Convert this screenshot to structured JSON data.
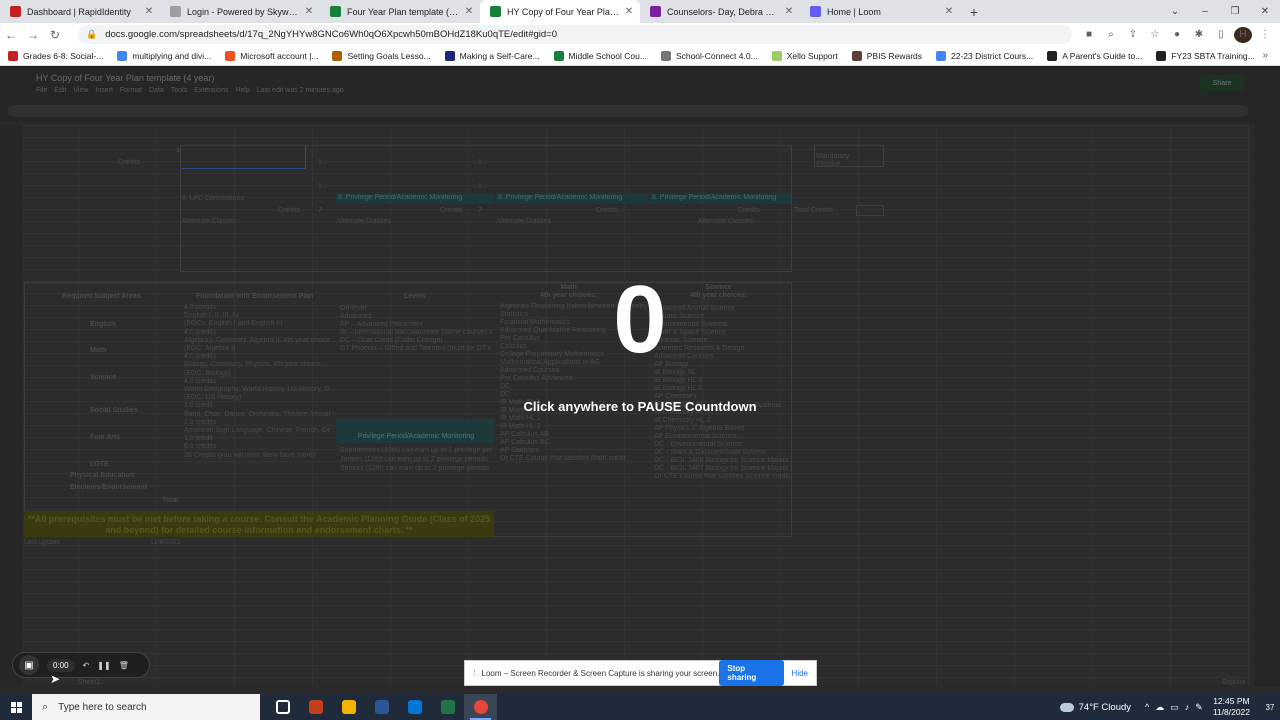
{
  "tabs": [
    {
      "title": "Dashboard | RapidIdentity",
      "color": "#c5221f"
    },
    {
      "title": "Login - Powered by Skyward",
      "color": "#9e9e9e"
    },
    {
      "title": "Four Year Plan template (4 year)",
      "color": "#188038"
    },
    {
      "title": "HY Copy of Four Year Plan template (4 year)",
      "color": "#188038",
      "active": true
    },
    {
      "title": "Counselors- Day, Debra & Young",
      "color": "#7b1fa2"
    },
    {
      "title": "Home | Loom",
      "color": "#625df5"
    }
  ],
  "new_tab_label": "+",
  "address_bar": {
    "url": "docs.google.com/spreadsheets/d/17q_2NgYHYw8GNCo6Wh0qO6Xpcwh50mBOHdZ18Ku0qTE/edit#gid=0"
  },
  "profile_initial": "H",
  "bookmarks": [
    {
      "label": "Grades 6-8: Social-...",
      "color": "#c5221f"
    },
    {
      "label": "multiplying and divi...",
      "color": "#4285f4"
    },
    {
      "label": "Microsoft account |...",
      "color": "#f25022"
    },
    {
      "label": "Setting Goals Lesso...",
      "color": "#b06000"
    },
    {
      "label": "Making a Self-Care...",
      "color": "#1a237e"
    },
    {
      "label": "Middle School Cou...",
      "color": "#188038"
    },
    {
      "label": "School-Connect 4.0...",
      "color": "#757575"
    },
    {
      "label": "Xello Support",
      "color": "#9ccc65"
    },
    {
      "label": "PBIS Rewards",
      "color": "#5d4037"
    },
    {
      "label": "22-23 District Cours...",
      "color": "#4285f4"
    },
    {
      "label": "A Parent's Guide to...",
      "color": "#202124"
    },
    {
      "label": "FY23 SBTA Training...",
      "color": "#212121"
    }
  ],
  "bookmarks_more": "»",
  "sheet": {
    "doc_title": "HY Copy of Four Year Plan template (4 year)",
    "menu": [
      "File",
      "Edit",
      "View",
      "Insert",
      "Format",
      "Data",
      "Tools",
      "Extensions",
      "Help",
      "Last edit was 2 minutes ago"
    ],
    "share_label": "Share",
    "credits_label": "Credits",
    "credits_value": "1",
    "mandatory_elective": "Mandatory Elective",
    "lfc_connections": "8. LFC Connections",
    "privilege_period": "8. Privilege Period/Academic Monitoring",
    "credits_7": "7",
    "total_credits": "Total Credits",
    "alternate_classes": "Alternate Classes",
    "headers": {
      "required": "Required Subject Areas",
      "foundation": "Foundation with Endorsement Plan",
      "levels": "Levels",
      "math": "Math\n4th year choices:",
      "science": "Science\n4th year choices:"
    },
    "subjects": [
      "English",
      "Math",
      "Science",
      "Social Studies",
      "Fine Arts",
      "LOTE",
      "Physical Education",
      "Electives/Endorsement",
      "Total"
    ],
    "foundation_lines": [
      "4.0 credits",
      "English I, II, III, IV",
      "(EOCs: English I and English II)",
      "4.0 credits",
      "Algebra I, Geometry, Algebra II, 4th year choice",
      "(EOC: Algebra I)",
      "4.0 credits",
      "Biology, Chemistry, Physics, 4th year choice",
      "(EOC: Biology)",
      "4.0 credits",
      "World Geography, World History, US History, Government/Economics",
      "(EOC: US History)",
      "1.0 credit",
      "Band, Choir, Dance, Orchestra, Theatre, Visual Arts",
      "2.0 credits",
      "American Sign Language, Chinese, French, German, Spanish",
      "1.0 credit",
      "6.0 credits",
      "26 Credits (you will most likely have more)"
    ],
    "levels_lines": [
      "On-level",
      "Advanced",
      "AP – Advanced Placement",
      "IB – International Baccalaureate (some courses are reserved for full diploma candidates)",
      "DC – Dual Credit (Collin College)",
      "GT Phoenix – Gifted and Talented (must be GT identified)"
    ],
    "privilege_header": "Privilege Period/Academic Monitoring",
    "privilege_lines": [
      "Sophomores (10th) can earn up to 1 privilege period",
      "Juniors (11th) can earn up to 2 privilege periods",
      "Seniors (12th) can earn up to 2 privilege periods"
    ],
    "math_lines": [
      "Algebraic Reasoning (taken between Geometry and Algebra 2)",
      "Statistics",
      "Financial Mathematics",
      "Advanced Quantitative Reasoning",
      "Pre Calculus",
      "Calculus",
      "College Preparatory Mathematics",
      "Mathematical Applications in AG",
      "Advanced Courses",
      "Pre Calculus Advanced",
      "DC",
      "DC",
      "IB Math SL 1",
      "IB Math SL 2",
      "IB Math HL 1",
      "IB Math HL 2",
      "AP Calculus AB",
      "AP Calculus BC",
      "AP Statistics",
      "Or CTE Course that satisfies Math credit"
    ],
    "science_lines": [
      "Advanced Animal Science",
      "Aquatic Science",
      "Environmental Systems",
      "Earth & Space Science",
      "Forensic Science",
      "Scientific Research & Design",
      "Advanced Courses",
      "AP Biology",
      "IB Biology SL",
      "IB Biology HL 1",
      "IB Biology HL 2",
      "AP Chemistry",
      "IB Chemistry SL",
      "IB Chemistry HL 1",
      "IB Chemistry HL 2",
      "AP Physics 2: Algebra Based",
      "AP Environmental Science",
      "DC - Environmental Science",
      "DC - Stars & Galaxies/Solar System",
      "DC - BIOL 1406 Biology for Science Majors",
      "DC - BIOL 1407 Biology for Science Majors II",
      "Or CTE Course that satisfies Science credit"
    ],
    "earth_systems_overflow": "Systems",
    "prereq_note": "**All prerequisites must be met before taking a course. Consult the Academic Planning Guide (Class of 2025 and beyond) for detailed course information and endorsement charts. **",
    "last_update_label": "Last update",
    "last_update_value": "11/8/2022",
    "sheet_tab": "Sheet1",
    "explore_label": "Explore"
  },
  "overlay": {
    "countdown": "0",
    "hint": "Click anywhere to PAUSE Countdown"
  },
  "loom_control": {
    "time": "0:00"
  },
  "share_bar": {
    "message": "Loom – Screen Recorder & Screen Capture is sharing your screen.",
    "stop_label": "Stop sharing",
    "hide_label": "Hide"
  },
  "taskbar": {
    "search_placeholder": "Type here to search",
    "apps": [
      {
        "name": "task-view",
        "color": "#ffffff"
      },
      {
        "name": "powerpoint",
        "color": "#c43e1c"
      },
      {
        "name": "file-explorer",
        "color": "#f4b400"
      },
      {
        "name": "word",
        "color": "#2b579a"
      },
      {
        "name": "outlook",
        "color": "#0078d4"
      },
      {
        "name": "excel",
        "color": "#217346"
      },
      {
        "name": "chrome",
        "color": "#e8453c",
        "active": true
      }
    ],
    "weather": "74°F  Cloudy",
    "time": "12:45 PM",
    "date": "11/8/2022",
    "notif_count": "37"
  }
}
